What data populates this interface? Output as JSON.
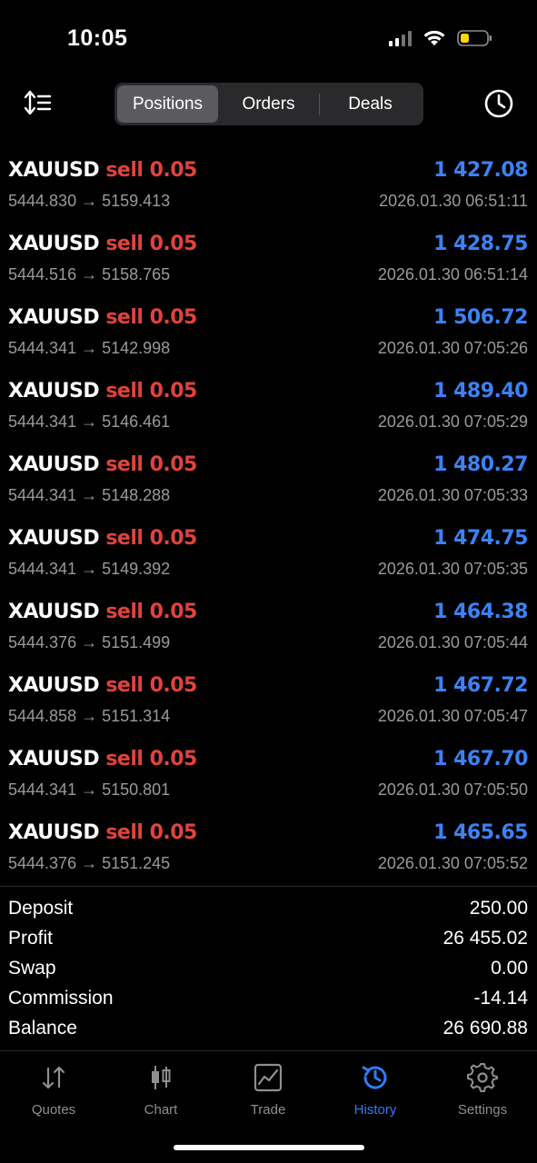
{
  "status_bar": {
    "time": "10:05"
  },
  "header": {
    "tabs": [
      {
        "label": "Positions",
        "active": true
      },
      {
        "label": "Orders",
        "active": false
      },
      {
        "label": "Deals",
        "active": false
      }
    ]
  },
  "trades": [
    {
      "symbol": "XAUUSD",
      "side": "sell 0.05",
      "prices": "5444.830 → 5159.413",
      "profit": "1 427.08",
      "time": "2026.01.30 06:51:11"
    },
    {
      "symbol": "XAUUSD",
      "side": "sell 0.05",
      "prices": "5444.516 → 5158.765",
      "profit": "1 428.75",
      "time": "2026.01.30 06:51:14"
    },
    {
      "symbol": "XAUUSD",
      "side": "sell 0.05",
      "prices": "5444.341 → 5142.998",
      "profit": "1 506.72",
      "time": "2026.01.30 07:05:26"
    },
    {
      "symbol": "XAUUSD",
      "side": "sell 0.05",
      "prices": "5444.341 → 5146.461",
      "profit": "1 489.40",
      "time": "2026.01.30 07:05:29"
    },
    {
      "symbol": "XAUUSD",
      "side": "sell 0.05",
      "prices": "5444.341 → 5148.288",
      "profit": "1 480.27",
      "time": "2026.01.30 07:05:33"
    },
    {
      "symbol": "XAUUSD",
      "side": "sell 0.05",
      "prices": "5444.341 → 5149.392",
      "profit": "1 474.75",
      "time": "2026.01.30 07:05:35"
    },
    {
      "symbol": "XAUUSD",
      "side": "sell 0.05",
      "prices": "5444.376 → 5151.499",
      "profit": "1 464.38",
      "time": "2026.01.30 07:05:44"
    },
    {
      "symbol": "XAUUSD",
      "side": "sell 0.05",
      "prices": "5444.858 → 5151.314",
      "profit": "1 467.72",
      "time": "2026.01.30 07:05:47"
    },
    {
      "symbol": "XAUUSD",
      "side": "sell 0.05",
      "prices": "5444.341 → 5150.801",
      "profit": "1 467.70",
      "time": "2026.01.30 07:05:50"
    },
    {
      "symbol": "XAUUSD",
      "side": "sell 0.05",
      "prices": "5444.376 → 5151.245",
      "profit": "1 465.65",
      "time": "2026.01.30 07:05:52"
    }
  ],
  "summary": [
    {
      "label": "Deposit",
      "value": "250.00"
    },
    {
      "label": "Profit",
      "value": "26 455.02"
    },
    {
      "label": "Swap",
      "value": "0.00"
    },
    {
      "label": "Commission",
      "value": "-14.14"
    },
    {
      "label": "Balance",
      "value": "26 690.88"
    }
  ],
  "tab_bar": {
    "items": [
      {
        "label": "Quotes",
        "icon": "arrows-up-down-icon",
        "active": false
      },
      {
        "label": "Chart",
        "icon": "candlestick-icon",
        "active": false
      },
      {
        "label": "Trade",
        "icon": "trend-chart-icon",
        "active": false
      },
      {
        "label": "History",
        "icon": "history-clock-icon",
        "active": true
      },
      {
        "label": "Settings",
        "icon": "gear-icon",
        "active": false
      }
    ]
  },
  "colors": {
    "sell": "#e0433c",
    "profit": "#3b82f6",
    "active_tab": "#2f7cf6",
    "muted": "#9a9a9e"
  }
}
